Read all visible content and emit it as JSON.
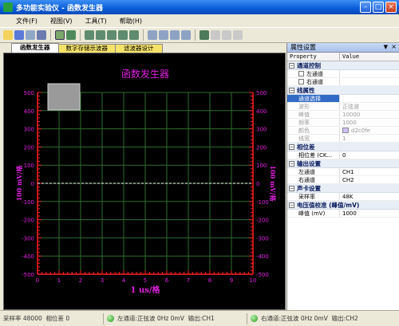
{
  "window": {
    "title": "多功能实验仪 - 函数发生器"
  },
  "menu": [
    "文件(F)",
    "视图(V)",
    "工具(T)",
    "帮助(H)"
  ],
  "tabs": [
    "函数发生器",
    "数字存储示波器",
    "滤波器设计"
  ],
  "chart_data": {
    "type": "line",
    "title": "函数发生器",
    "xlabel": "1 us/格",
    "ylabel_left": "100 mV/格",
    "ylabel_right": "100 mV/格",
    "xlim": [
      0,
      10
    ],
    "ylim": [
      -500,
      500
    ],
    "x_ticks": [
      0,
      1,
      2,
      3,
      4,
      5,
      6,
      7,
      8,
      9,
      10
    ],
    "y_ticks": [
      500,
      400,
      300,
      200,
      100,
      0,
      -100,
      -200,
      -300,
      -400,
      -500
    ],
    "grid": true,
    "series": [
      {
        "x": [
          0,
          10
        ],
        "y": [
          0,
          0
        ],
        "style": "dashed"
      }
    ],
    "colors": {
      "background": "#000000",
      "grid": "#2e6b2e",
      "axis": "#ff2020",
      "labels": "#e020e0",
      "trace": "#ffffff"
    }
  },
  "props": {
    "title": "属性设置",
    "col_property": "Property",
    "col_value": "Value",
    "sections": [
      {
        "label": "通道控制",
        "rows": [
          {
            "k": "左通道",
            "v": "",
            "check": true
          },
          {
            "k": "右通道",
            "v": "",
            "check": true
          }
        ]
      },
      {
        "label": "线属性",
        "rows": [
          {
            "k": "通道选择",
            "v": "",
            "selected": true
          },
          {
            "k": "波形",
            "v": "正弦波",
            "grey": true
          },
          {
            "k": "峰值",
            "v": "10000",
            "grey": true
          },
          {
            "k": "频率",
            "v": "1000",
            "grey": true
          },
          {
            "k": "颜色",
            "v": "d2c0fe",
            "grey": true,
            "swatch": true
          },
          {
            "k": "线宽",
            "v": "1",
            "grey": true
          }
        ]
      },
      {
        "label": "相位差",
        "rows": [
          {
            "k": "相位差 (CK...",
            "v": "0"
          }
        ]
      },
      {
        "label": "输出设置",
        "rows": [
          {
            "k": "左通道",
            "v": "CH1"
          },
          {
            "k": "右通道",
            "v": "CH2"
          }
        ]
      },
      {
        "label": "声卡设置",
        "rows": [
          {
            "k": "采样率",
            "v": "48K"
          }
        ]
      },
      {
        "label": "电压值校准 (峰值/mV)",
        "rows": [
          {
            "k": "峰值 (mV)",
            "v": "1000"
          }
        ]
      }
    ]
  },
  "status": {
    "sample": "采样率 48000",
    "phase": "相位差 0",
    "left": "左通道:正弦波",
    "left_val": "0Hz 0mV",
    "left_out": "输出:CH1",
    "right": "右通道:正弦波",
    "right_val": "0Hz 0mV",
    "right_out": "输出:CH2"
  }
}
